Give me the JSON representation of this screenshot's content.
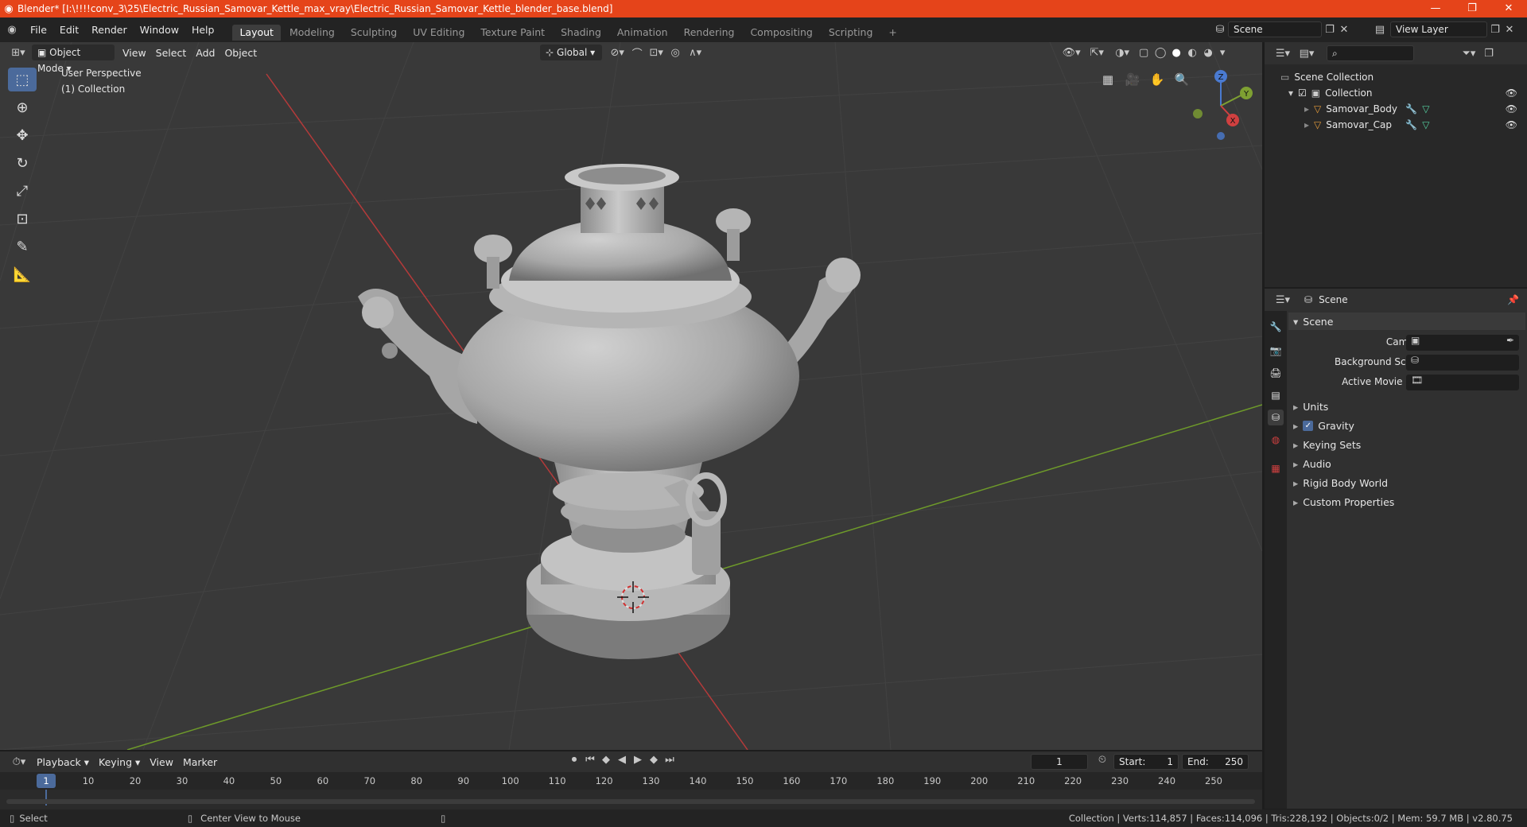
{
  "window": {
    "title": "Blender* [I:\\!!!!conv_3\\25\\Electric_Russian_Samovar_Kettle_max_vray\\Electric_Russian_Samovar_Kettle_blender_base.blend]",
    "minimize": "—",
    "maximize": "❐",
    "close": "✕"
  },
  "menu": [
    "File",
    "Edit",
    "Render",
    "Window",
    "Help"
  ],
  "workspaces": [
    "Layout",
    "Modeling",
    "Sculpting",
    "UV Editing",
    "Texture Paint",
    "Shading",
    "Animation",
    "Rendering",
    "Compositing",
    "Scripting"
  ],
  "active_workspace": "Layout",
  "add_workspace": "+",
  "scene_field": "Scene",
  "view_layer_field": "View Layer",
  "viewport": {
    "mode": "Object Mode",
    "menus": [
      "View",
      "Select",
      "Add",
      "Object"
    ],
    "orientation": "Global",
    "info_line1": "User Perspective",
    "info_line2": "(1) Collection",
    "gizmo_axes": {
      "x": "X",
      "y": "Y",
      "z": "Z"
    }
  },
  "outliner": {
    "root": "Scene Collection",
    "collection": "Collection",
    "objects": [
      "Samovar_Body",
      "Samovar_Cap"
    ]
  },
  "properties": {
    "header": "Scene",
    "panel": "Scene",
    "fields": [
      {
        "label": "Camera"
      },
      {
        "label": "Background Scene"
      },
      {
        "label": "Active Movie Clip"
      }
    ],
    "subpanels": [
      "Units",
      "Gravity",
      "Keying Sets",
      "Audio",
      "Rigid Body World",
      "Custom Properties"
    ]
  },
  "timeline": {
    "menus": [
      "Playback",
      "Keying",
      "View",
      "Marker"
    ],
    "current_frame": "1",
    "start_label": "Start:",
    "start": "1",
    "end_label": "End:",
    "end": "250",
    "ruler": [
      "1",
      "10",
      "20",
      "30",
      "40",
      "50",
      "60",
      "70",
      "80",
      "90",
      "100",
      "110",
      "120",
      "130",
      "140",
      "150",
      "160",
      "170",
      "180",
      "190",
      "200",
      "210",
      "220",
      "230",
      "240",
      "250"
    ]
  },
  "status": {
    "left": "Select",
    "middle": "Center View to Mouse",
    "right": "Collection | Verts:114,857 | Faces:114,096 | Tris:228,192 | Objects:0/2 | Mem: 59.7 MB | v2.80.75"
  },
  "colors": {
    "titlebar": "#e5441a",
    "accent": "#4b6a9b",
    "viewport_bg": "#393939",
    "axis_x": "#c83a3a",
    "axis_y": "#7ea032"
  }
}
